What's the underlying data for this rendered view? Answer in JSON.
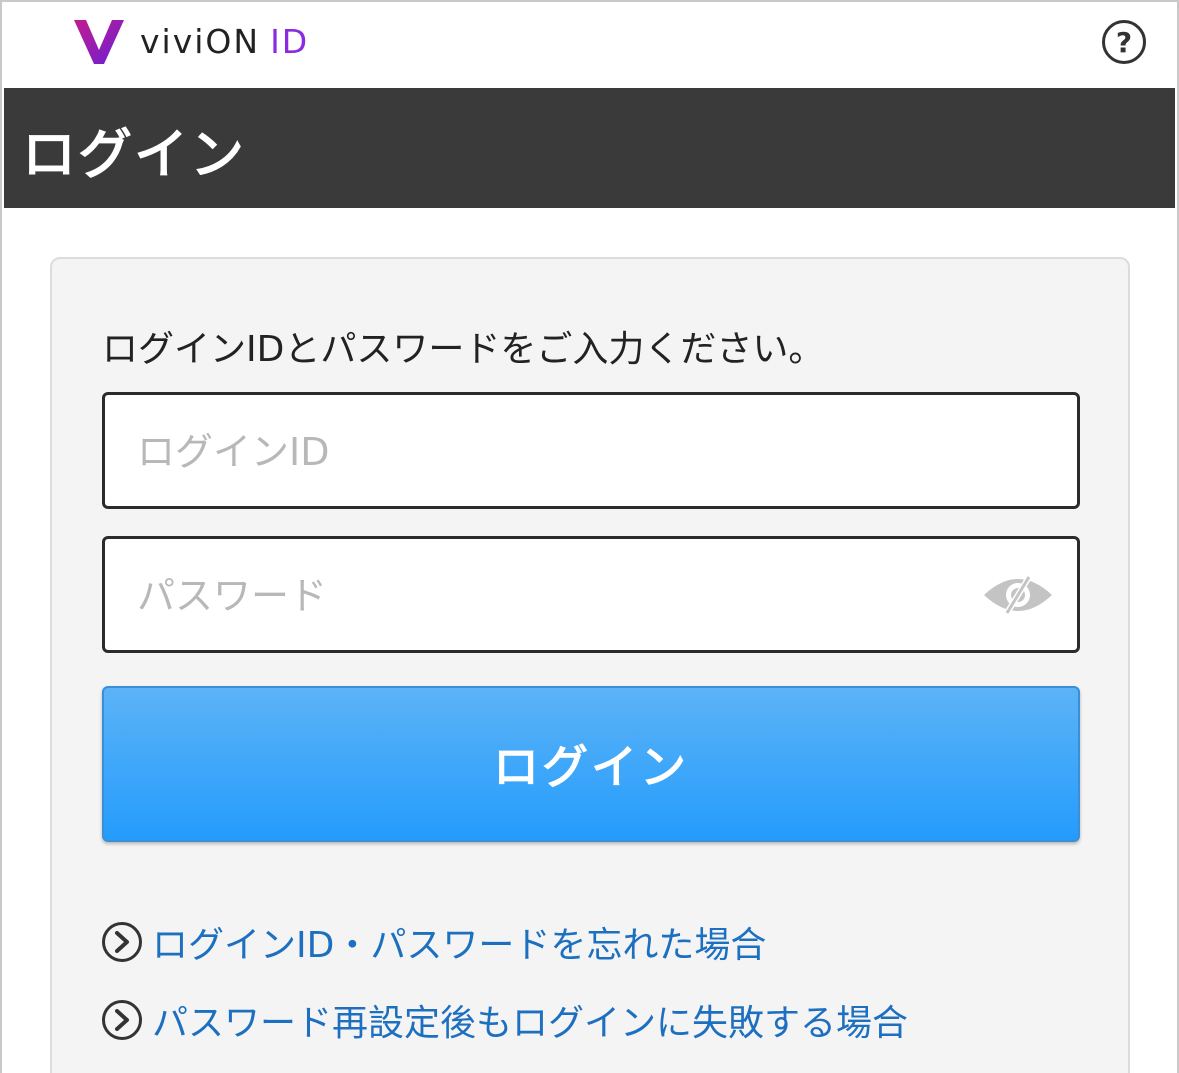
{
  "header": {
    "logo_text": "viviON",
    "logo_suffix": "ID",
    "help_label": "?"
  },
  "title": "ログイン",
  "form": {
    "instruction": "ログインIDとパスワードをご入力ください。",
    "login_id": {
      "value": "",
      "placeholder": "ログインID"
    },
    "password": {
      "value": "",
      "placeholder": "パスワード"
    },
    "submit_label": "ログイン"
  },
  "links": [
    {
      "label": "ログインID・パスワードを忘れた場合"
    },
    {
      "label": "パスワード再設定後もログインに失敗する場合"
    }
  ],
  "colors": {
    "logo_mark": "#8a1fc7",
    "accent_blue": "#249cfc",
    "link_blue": "#1d6fc0",
    "titlebar": "#3a3a3a"
  },
  "icons": [
    "vivion-logo-icon",
    "help-icon",
    "eye-slash-icon",
    "chevron-right-icon"
  ]
}
